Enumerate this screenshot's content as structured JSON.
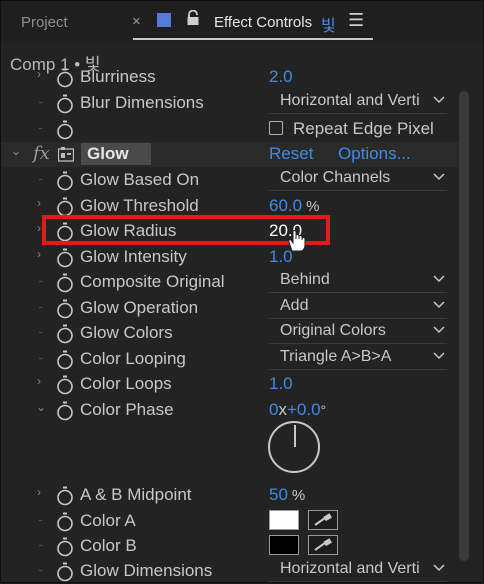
{
  "tabs": {
    "project_label": "Project",
    "close_glyph": "×",
    "effect_controls_label": "Effect Controls",
    "effect_controls_layer": "빛",
    "menu_glyph": "☰",
    "swatch_color": "#5a7ad8"
  },
  "comp_title": "Comp 1 • 빛",
  "rows": {
    "blurriness": {
      "label": "Blurriness",
      "value": "2.0"
    },
    "blur_dimensions": {
      "label": "Blur Dimensions",
      "selected": "Horizontal and Verti"
    },
    "repeat_edge": {
      "label": "Repeat Edge Pixel",
      "checked": false
    },
    "glow": {
      "fx": "fx",
      "name": "Glow",
      "reset": "Reset",
      "options": "Options..."
    },
    "glow_based_on": {
      "label": "Glow Based On",
      "selected": "Color Channels"
    },
    "glow_threshold": {
      "label": "Glow Threshold",
      "value": "60.0",
      "unit": "%"
    },
    "glow_radius": {
      "label": "Glow Radius",
      "value": "20.0"
    },
    "glow_intensity": {
      "label": "Glow Intensity",
      "value": "1.0"
    },
    "composite_original": {
      "label": "Composite Original",
      "selected": "Behind"
    },
    "glow_operation": {
      "label": "Glow Operation",
      "selected": "Add"
    },
    "glow_colors": {
      "label": "Glow Colors",
      "selected": "Original Colors"
    },
    "color_looping": {
      "label": "Color Looping",
      "selected": "Triangle A>B>A"
    },
    "color_loops": {
      "label": "Color Loops",
      "value": "1.0"
    },
    "color_phase": {
      "label": "Color Phase",
      "revolutions": "0",
      "x": "x",
      "degrees": "+0.0",
      "degree_symbol": "°"
    },
    "ab_midpoint": {
      "label": "A & B Midpoint",
      "value": "50",
      "unit": "%"
    },
    "color_a": {
      "label": "Color A",
      "color": "#ffffff"
    },
    "color_b": {
      "label": "Color B",
      "color": "#000000"
    },
    "glow_dimensions": {
      "label": "Glow Dimensions",
      "selected": "Horizontal and Verti"
    }
  },
  "colors": {
    "accent_value": "#3e8ce8",
    "highlight": "#e01b1b"
  }
}
